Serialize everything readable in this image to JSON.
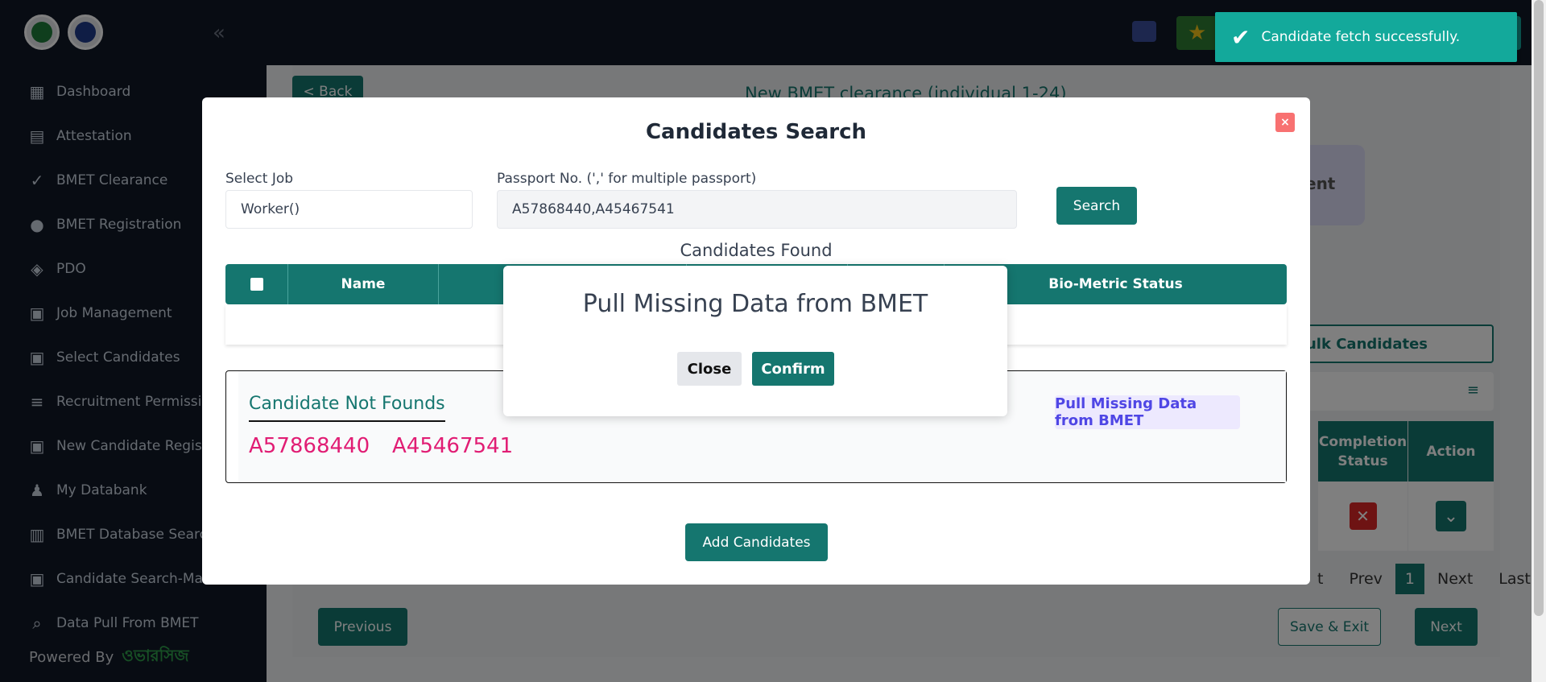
{
  "sidebar": {
    "collapse_glyph": "«",
    "items": [
      {
        "label": "Dashboard",
        "icon": "dashboard-icon"
      },
      {
        "label": "Attestation",
        "icon": "document-icon"
      },
      {
        "label": "BMET Clearance",
        "icon": "check-icon"
      },
      {
        "label": "BMET Registration",
        "icon": "palette-icon"
      },
      {
        "label": "PDO",
        "icon": "layers-icon"
      },
      {
        "label": "Job Management",
        "icon": "badge-icon"
      },
      {
        "label": "Select Candidates",
        "icon": "person-card-icon"
      },
      {
        "label": "Recruitment Permission",
        "icon": "list-icon"
      },
      {
        "label": "New Candidate Registration",
        "icon": "badge-icon"
      },
      {
        "label": "My Databank",
        "icon": "people-icon"
      },
      {
        "label": "BMET Database Search",
        "icon": "wallet-icon"
      },
      {
        "label": "Candidate Search-Ma",
        "icon": "badge-icon"
      },
      {
        "label": "Data Pull From BMET",
        "icon": "search-icon"
      }
    ],
    "powered_by": "Powered By",
    "brand": "ওভারসিজ"
  },
  "toast": {
    "message": "Candidate fetch successfully."
  },
  "background": {
    "back_label": "< Back",
    "page_title": "New BMET clearance (individual 1-24)",
    "card_text": "ent",
    "bulk_label": "Bulk Candidates",
    "filter_icon": "≡",
    "columns": [
      "Completion Status",
      "Action"
    ],
    "pager": {
      "items": [
        "t",
        "Prev",
        "1",
        "Next",
        "Last"
      ]
    },
    "previous_label": "Previous",
    "save_exit_label": "Save & Exit",
    "next_label": "Next"
  },
  "modal": {
    "title": "Candidates Search",
    "close_glyph": "×",
    "job_label": "Select Job",
    "job_value": "Worker()",
    "passport_label": "Passport No. (',' for multiple passport)",
    "passport_value": "A57868440,A45467541",
    "search_label": "Search",
    "found_title": "Candidates Found",
    "headers": {
      "name": "Name",
      "biometric": "Bio-Metric Status"
    },
    "not_found_title": "Candidate Not Founds",
    "not_found_passports": [
      "A57868440",
      "A45467541"
    ],
    "pull_label": "Pull Missing Data from BMET",
    "add_label": "Add Candidates"
  },
  "dialog": {
    "title": "Pull Missing Data from BMET",
    "close_label": "Close",
    "confirm_label": "Confirm"
  },
  "colors": {
    "primary": "#15766f",
    "sidebar": "#111827",
    "toast": "#13a99b",
    "danger": "#dc2626",
    "passport": "#e11d74"
  }
}
